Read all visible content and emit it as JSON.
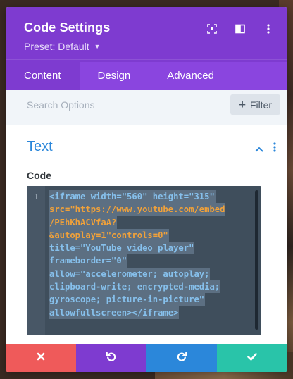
{
  "header": {
    "title": "Code Settings",
    "preset_label": "Preset: Default",
    "icons": [
      "focus-icon",
      "split-view-icon",
      "more-vertical-icon"
    ]
  },
  "tabs": [
    {
      "label": "Content",
      "active": true
    },
    {
      "label": "Design",
      "active": false
    },
    {
      "label": "Advanced",
      "active": false
    }
  ],
  "search": {
    "placeholder": "Search Options",
    "filter_label": "Filter"
  },
  "section": {
    "title": "Text",
    "field_label": "Code"
  },
  "editor": {
    "line_number": "1",
    "lines": [
      "<iframe width=\"560\" height=\"315\"",
      "src=\"https://www.youtube.com/embed",
      "/PEhKhACVfaA?",
      "&autoplay=1\"controls=0\"",
      "title=\"YouTube video player\"",
      "frameborder=\"0\"",
      "allow=\"accelerometer; autoplay;",
      "clipboard-write; encrypted-media;",
      "gyroscope; picture-in-picture\"",
      "allowfullscreen></iframe>"
    ]
  },
  "footer": {
    "buttons": [
      "cancel-icon",
      "undo-icon",
      "redo-icon",
      "save-icon"
    ]
  },
  "colors": {
    "header": "#7e3bd0",
    "tabs": "#8a45df",
    "accent_blue": "#2b87da",
    "cancel": "#ef5a5a",
    "save": "#29c4a9"
  }
}
